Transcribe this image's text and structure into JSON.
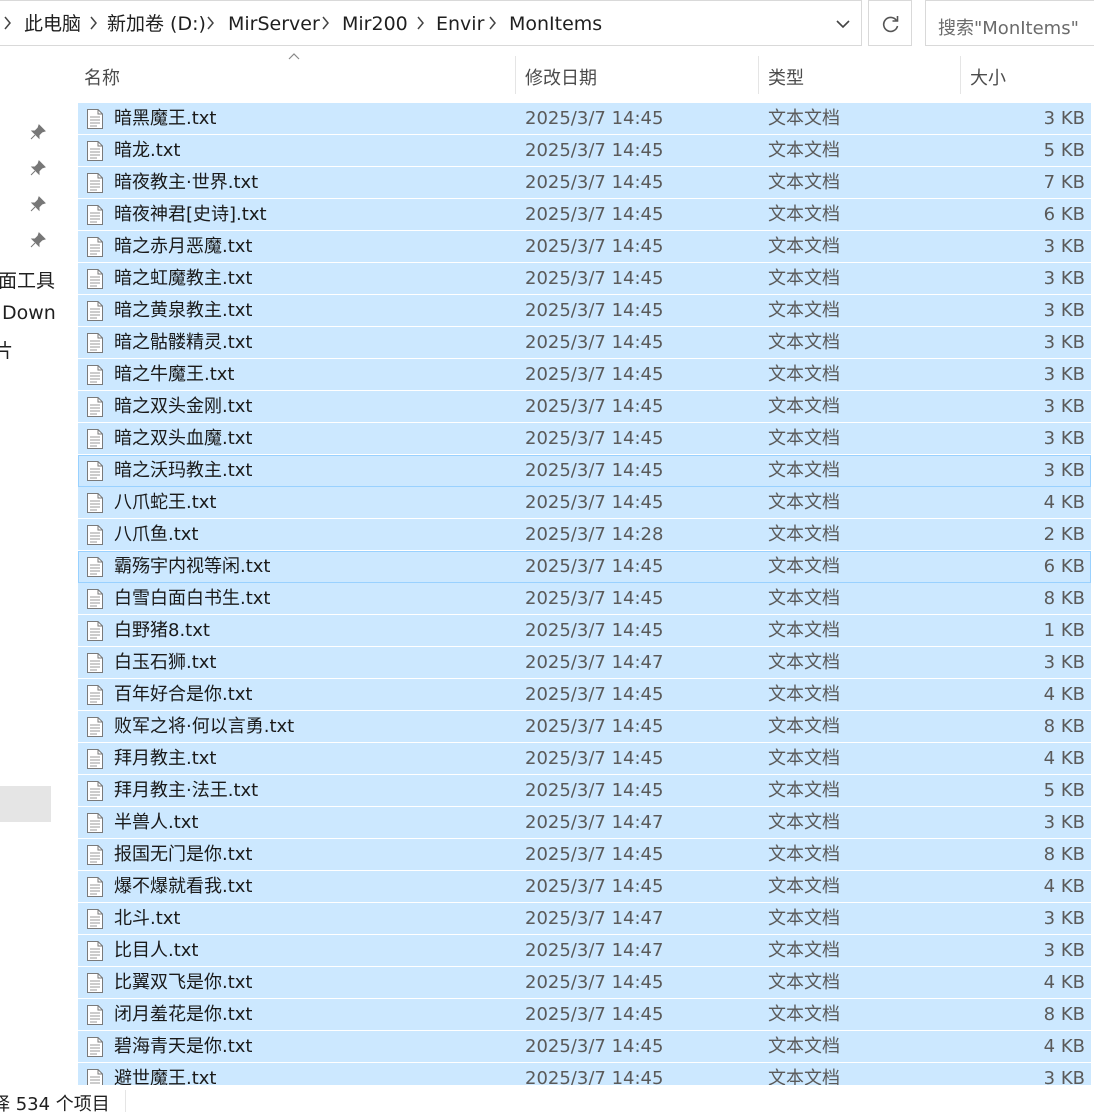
{
  "breadcrumb": [
    "此电脑",
    "新加卷 (D:)",
    "MirServer",
    "Mir200",
    "Envir",
    "MonItems"
  ],
  "search": {
    "placeholder": "搜索\"MonItems\""
  },
  "nav_pane": {
    "items": [
      "面工具",
      "Down",
      "片"
    ]
  },
  "columns": {
    "name": "名称",
    "date": "修改日期",
    "type": "类型",
    "size": "大小"
  },
  "files": [
    {
      "name": "暗黑魔王.txt",
      "date": "2025/3/7 14:45",
      "type": "文本文档",
      "size": "3 KB"
    },
    {
      "name": "暗龙.txt",
      "date": "2025/3/7 14:45",
      "type": "文本文档",
      "size": "5 KB"
    },
    {
      "name": "暗夜教主·世界.txt",
      "date": "2025/3/7 14:45",
      "type": "文本文档",
      "size": "7 KB"
    },
    {
      "name": "暗夜神君[史诗].txt",
      "date": "2025/3/7 14:45",
      "type": "文本文档",
      "size": "6 KB"
    },
    {
      "name": "暗之赤月恶魔.txt",
      "date": "2025/3/7 14:45",
      "type": "文本文档",
      "size": "3 KB"
    },
    {
      "name": "暗之虹魔教主.txt",
      "date": "2025/3/7 14:45",
      "type": "文本文档",
      "size": "3 KB"
    },
    {
      "name": "暗之黄泉教主.txt",
      "date": "2025/3/7 14:45",
      "type": "文本文档",
      "size": "3 KB"
    },
    {
      "name": "暗之骷髅精灵.txt",
      "date": "2025/3/7 14:45",
      "type": "文本文档",
      "size": "3 KB"
    },
    {
      "name": "暗之牛魔王.txt",
      "date": "2025/3/7 14:45",
      "type": "文本文档",
      "size": "3 KB"
    },
    {
      "name": "暗之双头金刚.txt",
      "date": "2025/3/7 14:45",
      "type": "文本文档",
      "size": "3 KB"
    },
    {
      "name": "暗之双头血魔.txt",
      "date": "2025/3/7 14:45",
      "type": "文本文档",
      "size": "3 KB"
    },
    {
      "name": "暗之沃玛教主.txt",
      "date": "2025/3/7 14:45",
      "type": "文本文档",
      "size": "3 KB"
    },
    {
      "name": "八爪蛇王.txt",
      "date": "2025/3/7 14:45",
      "type": "文本文档",
      "size": "4 KB"
    },
    {
      "name": "八爪鱼.txt",
      "date": "2025/3/7 14:28",
      "type": "文本文档",
      "size": "2 KB"
    },
    {
      "name": "霸殇宇内视等闲.txt",
      "date": "2025/3/7 14:45",
      "type": "文本文档",
      "size": "6 KB"
    },
    {
      "name": "白雪白面白书生.txt",
      "date": "2025/3/7 14:45",
      "type": "文本文档",
      "size": "8 KB"
    },
    {
      "name": "白野猪8.txt",
      "date": "2025/3/7 14:45",
      "type": "文本文档",
      "size": "1 KB"
    },
    {
      "name": "白玉石狮.txt",
      "date": "2025/3/7 14:47",
      "type": "文本文档",
      "size": "3 KB"
    },
    {
      "name": "百年好合是你.txt",
      "date": "2025/3/7 14:45",
      "type": "文本文档",
      "size": "4 KB"
    },
    {
      "name": "败军之将·何以言勇.txt",
      "date": "2025/3/7 14:45",
      "type": "文本文档",
      "size": "8 KB"
    },
    {
      "name": "拜月教主.txt",
      "date": "2025/3/7 14:45",
      "type": "文本文档",
      "size": "4 KB"
    },
    {
      "name": "拜月教主·法王.txt",
      "date": "2025/3/7 14:45",
      "type": "文本文档",
      "size": "5 KB"
    },
    {
      "name": "半兽人.txt",
      "date": "2025/3/7 14:47",
      "type": "文本文档",
      "size": "3 KB"
    },
    {
      "name": "报国无门是你.txt",
      "date": "2025/3/7 14:45",
      "type": "文本文档",
      "size": "8 KB"
    },
    {
      "name": "爆不爆就看我.txt",
      "date": "2025/3/7 14:45",
      "type": "文本文档",
      "size": "4 KB"
    },
    {
      "name": "北斗.txt",
      "date": "2025/3/7 14:47",
      "type": "文本文档",
      "size": "3 KB"
    },
    {
      "name": "比目人.txt",
      "date": "2025/3/7 14:47",
      "type": "文本文档",
      "size": "3 KB"
    },
    {
      "name": "比翼双飞是你.txt",
      "date": "2025/3/7 14:45",
      "type": "文本文档",
      "size": "4 KB"
    },
    {
      "name": "闭月羞花是你.txt",
      "date": "2025/3/7 14:45",
      "type": "文本文档",
      "size": "8 KB"
    },
    {
      "name": "碧海青天是你.txt",
      "date": "2025/3/7 14:45",
      "type": "文本文档",
      "size": "4 KB"
    },
    {
      "name": "避世魔王.txt",
      "date": "2025/3/7 14:45",
      "type": "文本文档",
      "size": "3 KB"
    }
  ],
  "statusbar": {
    "text": "择 534 个项目"
  },
  "colors": {
    "selection": "#cce8ff",
    "focus_border": "#99d1ff",
    "text": "#1f1f1f",
    "muted": "#5a5a5a"
  }
}
